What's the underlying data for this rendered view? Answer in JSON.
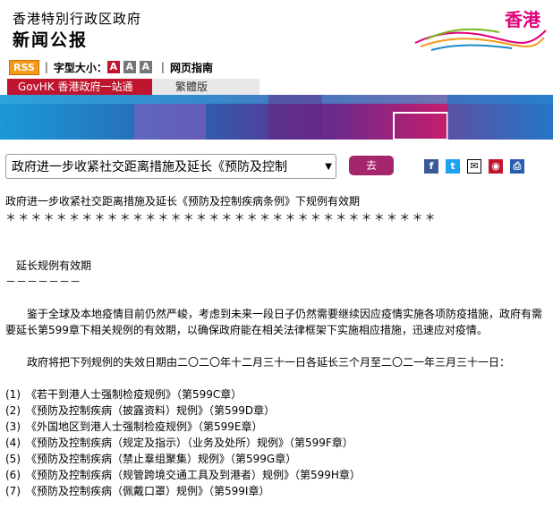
{
  "header": {
    "org": "香港特別行政区政府",
    "section": "新闻公报",
    "logo_text": "香港"
  },
  "toolbar": {
    "rss": "RSS",
    "font_size_label": "字型大小：",
    "font_buttons": [
      "A",
      "A",
      "A"
    ],
    "guide": "网页指南"
  },
  "tabs": {
    "govhk": "GovHK 香港政府一站通",
    "traditional": "繁體版"
  },
  "selector": {
    "value": "政府进一步收紧社交距离措施及延长《预防及控制",
    "go": "去"
  },
  "share_icons": [
    "facebook-icon",
    "twitter-icon",
    "email-icon",
    "weibo-icon",
    "print-icon"
  ],
  "article": {
    "title": "政府进一步收紧社交距离措施及延长《预防及控制疾病条例》下规例有效期",
    "stars": "＊＊＊＊＊＊＊＊＊＊＊＊＊＊＊＊＊＊＊＊＊＊＊＊＊＊＊＊＊＊＊＊＊＊",
    "subhead": "延长规例有效期",
    "dashes": "－－－－－－－",
    "para1": "鉴于全球及本地疫情目前仍然严峻，考虑到未来一段日子仍然需要继续因应疫情实施各项防疫措施，政府有需要延长第599章下相关规例的有效期，以确保政府能在相关法律框架下实施相应措施，迅速应对疫情。",
    "para2": "政府将把下列规例的失效日期由二〇二〇年十二月三十一日各延长三个月至二〇二一年三月三十一日：",
    "items": [
      "(1)　《若干到港人士强制检疫规例》（第599C章）",
      "(2)　《预防及控制疾病（披露资料）规例》（第599D章）",
      "(3)　《外国地区到港人士强制检疫规例》（第599E章）",
      "(4)　《预防及控制疾病（规定及指示）（业务及处所）规例》（第599F章）",
      "(5)　《预防及控制疾病（禁止羣组聚集）规例》（第599G章）",
      "(6)　《预防及控制疾病（规管跨境交通工具及到港者）规例》（第599H章）",
      "(7)　《预防及控制疾病（佩戴口罩）规例》（第599I章）"
    ]
  }
}
